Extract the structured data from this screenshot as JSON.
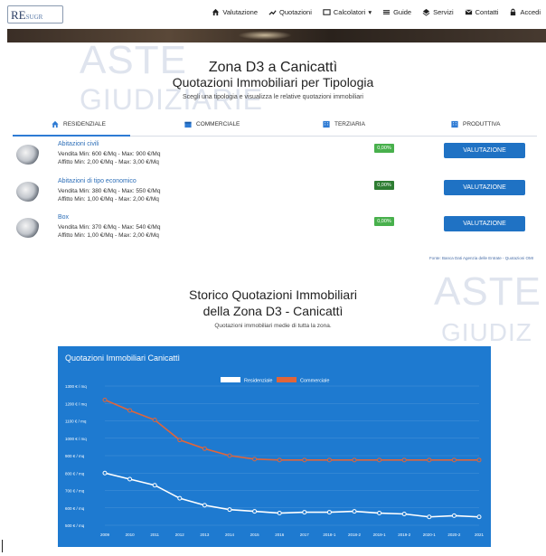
{
  "header": {
    "logo": "RE",
    "logo_sub": "SUGR",
    "nav": [
      {
        "label": "Valutazione",
        "icon": "home-icon"
      },
      {
        "label": "Quotazioni",
        "icon": "trend-icon"
      },
      {
        "label": "Calcolatori",
        "icon": "calculator-icon"
      },
      {
        "label": "Guide",
        "icon": "guide-icon"
      },
      {
        "label": "Servizi",
        "icon": "layers-icon"
      },
      {
        "label": "Contatti",
        "icon": "mail-icon"
      },
      {
        "label": "Accedi",
        "icon": "lock-icon"
      }
    ]
  },
  "watermarks": {
    "aste": "ASTE",
    "giudiziarie": "GIUDIZIARIE",
    "giudiz": "GIUDIZ"
  },
  "page": {
    "title_line1": "Zona D3 a Canicattì",
    "title_line2": "Quotazioni Immobiliari per Tipologia",
    "subtitle": "Scegli una tipologia e visualizza le relative quotazioni immobiliari"
  },
  "tabs": [
    {
      "label": "RESIDENZIALE",
      "icon": "home-icon"
    },
    {
      "label": "COMMERCIALE",
      "icon": "shop-icon"
    },
    {
      "label": "TERZIARIA",
      "icon": "building-icon"
    },
    {
      "label": "PRODUTTIVA",
      "icon": "factory-icon"
    }
  ],
  "listings": [
    {
      "title": "Abitazioni civili",
      "vendita": "Vendita Min: 600 €/Mq - Max: 900 €/Mq",
      "affitto": "Affitto Min: 2,00 €/Mq - Max: 3,00 €/Mq",
      "badge": "0,00%",
      "button": "VALUTAZIONE"
    },
    {
      "title": "Abitazioni di tipo economico",
      "vendita": "Vendita Min: 380 €/Mq - Max: 550 €/Mq",
      "affitto": "Affitto Min: 1,00 €/Mq - Max: 2,00 €/Mq",
      "badge": "0,00%",
      "button": "VALUTAZIONE"
    },
    {
      "title": "Box",
      "vendita": "Vendita Min: 370 €/Mq - Max: 540 €/Mq",
      "affitto": "Affitto Min: 1,00 €/Mq - Max: 2,00 €/Mq",
      "badge": "0,00%",
      "button": "VALUTAZIONE"
    }
  ],
  "source": "Fonte: Banca Dati Agenzia delle Entrate - Quotazioni OMI",
  "history": {
    "title_line1": "Storico Quotazioni Immobiliari",
    "title_line2": "della Zona D3 - Canicattì",
    "subtitle": "Quotazioni immobiliari medie di tutta la zona."
  },
  "chart_data": {
    "type": "line",
    "title": "Quotazioni Immobiliari Canicattì",
    "categories": [
      "2009",
      "2010",
      "2011",
      "2012",
      "2013",
      "2014",
      "2015",
      "2016",
      "2017",
      "2018-1",
      "2018-2",
      "2019-1",
      "2019-2",
      "2020-1",
      "2020-2",
      "2021"
    ],
    "series": [
      {
        "name": "Residenziale",
        "color": "#ffffff",
        "values": [
          800,
          765,
          730,
          655,
          615,
          590,
          580,
          570,
          575,
          575,
          580,
          570,
          565,
          548,
          555,
          548
        ]
      },
      {
        "name": "Commerciale",
        "color": "#e0653a",
        "values": [
          1220,
          1160,
          1105,
          990,
          940,
          900,
          880,
          875,
          875,
          875,
          875,
          875,
          875,
          875,
          875,
          875
        ]
      }
    ],
    "yticks": [
      "1300 € / mq",
      "1200 € / mq",
      "1100 € / mq",
      "1000 € / mq",
      "900 € / mq",
      "800 € / mq",
      "700 € / mq",
      "600 € / mq",
      "500 € / mq"
    ],
    "ylim": [
      500,
      1300
    ],
    "legend": "top-center",
    "background": "#1e7ad0"
  }
}
